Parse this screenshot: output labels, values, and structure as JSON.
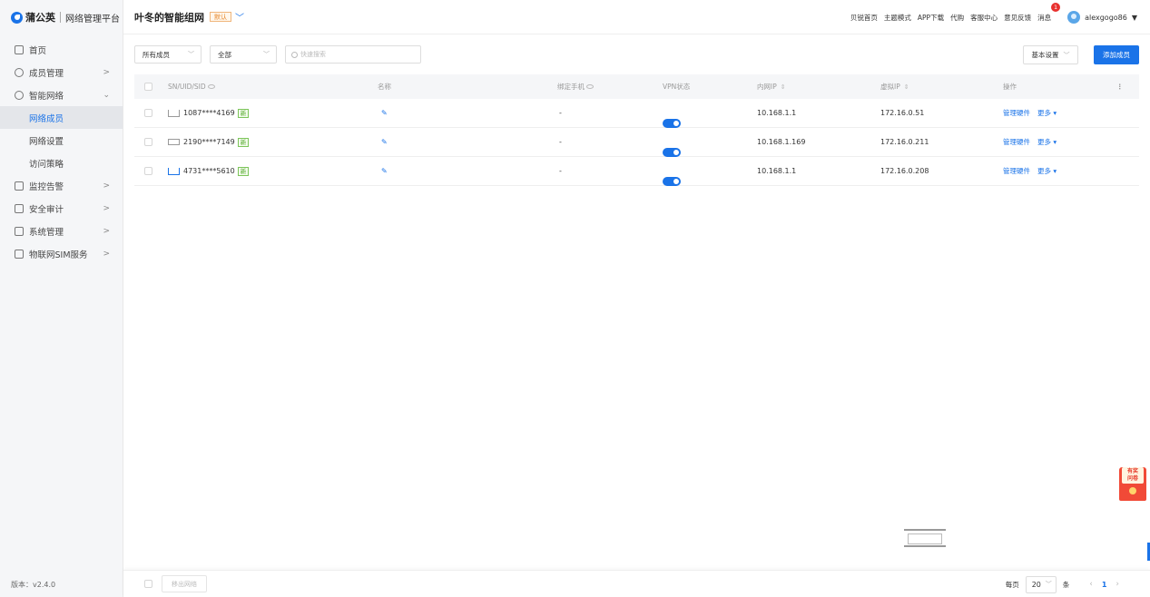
{
  "brand": {
    "name": "蒲公英",
    "subtitle": "网络管理平台"
  },
  "sidebar": {
    "items": [
      {
        "label": "首页",
        "icon": "home-icon",
        "arrow": ""
      },
      {
        "label": "成员管理",
        "icon": "user-icon",
        "arrow": ">"
      },
      {
        "label": "智能网络",
        "icon": "network-icon",
        "arrow": "⌄"
      }
    ],
    "sub_items": [
      {
        "label": "网络成员",
        "active": true
      },
      {
        "label": "网络设置",
        "active": false
      },
      {
        "label": "访问策略",
        "active": false
      }
    ],
    "items2": [
      {
        "label": "监控告警",
        "icon": "monitor-icon",
        "arrow": ">"
      },
      {
        "label": "安全审计",
        "icon": "audit-icon",
        "arrow": ">"
      },
      {
        "label": "系统管理",
        "icon": "system-icon",
        "arrow": ">"
      },
      {
        "label": "物联网SIM服务",
        "icon": "sim-icon",
        "arrow": ">"
      }
    ],
    "version": "版本：v2.4.0"
  },
  "header": {
    "network_title": "叶冬的智能组网",
    "default_tag": "默认",
    "links": [
      "贝锐首页",
      "主题模式",
      "APP下载",
      "代购",
      "客服中心",
      "意见反馈"
    ],
    "messages_label": "消息",
    "messages_badge": "1",
    "username": "alexgogo86"
  },
  "toolbar": {
    "member_filter": "所有成员",
    "status_filter": "全部",
    "search_placeholder": "快速搜索",
    "basic_settings": "基本设置",
    "add_member": "添加成员"
  },
  "table": {
    "columns": {
      "sn": "SN/UID/SID",
      "name": "名称",
      "phone": "绑定手机",
      "vpn": "VPN状态",
      "lan_ip": "内网IP",
      "virtual_ip": "虚拟IP",
      "actions": "操作"
    },
    "rows": [
      {
        "sn": "1087****4169",
        "tag": "新",
        "phone": "-",
        "vpn_on": true,
        "lan_ip": "10.168.1.1",
        "virtual_ip": "172.16.0.51",
        "manage": "管理硬件",
        "more": "更多 ▾"
      },
      {
        "sn": "2190****7149",
        "tag": "新",
        "phone": "-",
        "vpn_on": true,
        "lan_ip": "10.168.1.169",
        "virtual_ip": "172.16.0.211",
        "manage": "管理硬件",
        "more": "更多 ▾"
      },
      {
        "sn": "4731****5610",
        "tag": "新",
        "phone": "-",
        "vpn_on": true,
        "lan_ip": "10.168.1.1",
        "virtual_ip": "172.16.0.208",
        "manage": "管理硬件",
        "more": "更多 ▾"
      }
    ]
  },
  "footer": {
    "remove_label": "移出网络",
    "per_page_label": "每页",
    "page_size": "20",
    "unit_label": "条",
    "current_page": "1"
  },
  "survey": {
    "line1": "有奖",
    "line2": "问卷"
  },
  "colors": {
    "accent": "#1a73e8",
    "badge": "#e8312f",
    "new_tag": "#52a829",
    "default_tag": "#e6872b"
  }
}
